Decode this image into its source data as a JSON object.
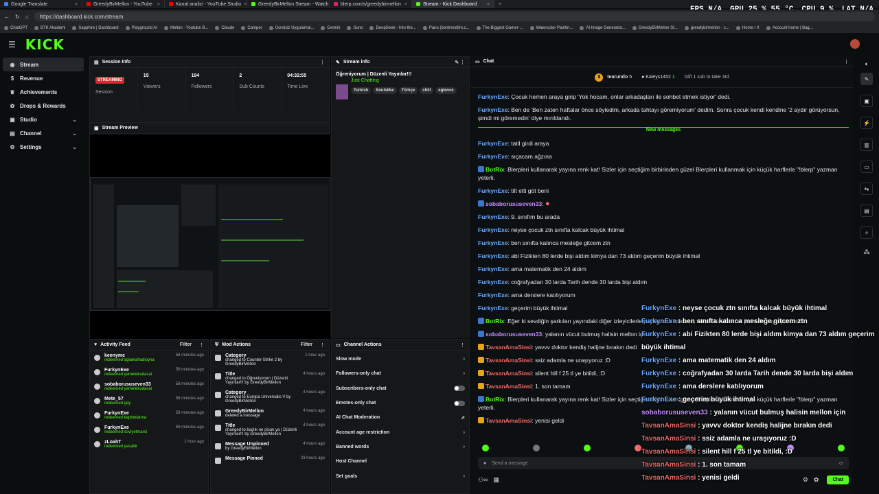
{
  "browser": {
    "tabs": [
      {
        "title": "Google Translate",
        "color": "#4285f4"
      },
      {
        "title": "GreedyBirMellon - YouTube",
        "color": "#ff0000"
      },
      {
        "title": "Kanal analizi - YouTube Studio",
        "color": "#ff0000"
      },
      {
        "title": "GreedyBirMellon Stream - Watch",
        "color": "#53fc18"
      },
      {
        "title": "blerp.com/s/greedybirmellon",
        "color": "#e0245e"
      },
      {
        "title": "Stream - Kick Dashboard",
        "color": "#53fc18",
        "active": true
      }
    ],
    "url": "https://dashboard.kick.com/stream",
    "bookmarks": [
      "ChatGPT",
      "BTK Akademi",
      "Sapphire | Dashboard",
      "Playground AI",
      "Mellon - Youtube B...",
      "Claude",
      "Camper",
      "Ücretsiz Uygulamal...",
      "Gemini",
      "Suno",
      "DeepSeek - Into the...",
      "Pano (bentrendlim.c...",
      "The Biggest Gamer-...",
      "Watercolor Paintin...",
      "AI Image Generator...",
      "GreedyBirMellon St...",
      "greedybirmellon - s...",
      "Home / X",
      "Account home | Bag..."
    ]
  },
  "hud": {
    "fps_label": "FPS",
    "fps": "N/A",
    "gpu_label": "GPU",
    "gpu": "25 % 55 °C",
    "cpu_label": "CPU",
    "cpu": "9 %",
    "lat_label": "LAT",
    "lat": "N/A"
  },
  "brand": {
    "logo": "KICK",
    "accent": "#53fc18"
  },
  "sidebar": {
    "items": [
      {
        "label": "Stream",
        "active": true,
        "icon": "broadcast-icon"
      },
      {
        "label": "Revenue",
        "icon": "revenue-icon"
      },
      {
        "label": "Achievements",
        "icon": "trophy-icon"
      },
      {
        "label": "Drops & Rewards",
        "icon": "gift-icon"
      },
      {
        "label": "Studio",
        "icon": "studio-icon",
        "chevron": true
      },
      {
        "label": "Channel",
        "icon": "channel-icon",
        "chevron": true
      },
      {
        "label": "Settings",
        "icon": "gear-icon",
        "chevron": true
      }
    ]
  },
  "session": {
    "title": "Session Info",
    "status": "STREAMING",
    "status_label": "Session",
    "stats": [
      {
        "value": "15",
        "label": "Viewers"
      },
      {
        "value": "194",
        "label": "Followers"
      },
      {
        "value": "2",
        "label": "Sub Counts"
      },
      {
        "value": "04:32:55",
        "label": "Time Live"
      }
    ]
  },
  "preview": {
    "title": "Stream Preview"
  },
  "stream_info": {
    "title": "Stream info",
    "stream_title": "Öğreniyorum | Düzenli Yayınlar!!!",
    "category": "Just Chatting",
    "tags": [
      "Turkish",
      "Soulslike",
      "Türkçe",
      "chill",
      "eglence"
    ]
  },
  "activity": {
    "title": "Activity Feed",
    "filter": "Filter",
    "items": [
      {
        "user": "keenymc",
        "detail": "redeemed aglamahadioyna",
        "time": "58 minutes ago"
      },
      {
        "user": "FurkynExe",
        "detail": "redeemed yametekudasai",
        "time": "58 minutes ago"
      },
      {
        "user": "sobaborususeven33",
        "detail": "redeemed yametekudasai",
        "time": "58 minutes ago"
      },
      {
        "user": "Mete_57",
        "detail": "redeemed gay",
        "time": "58 minutes ago"
      },
      {
        "user": "FurkynExe",
        "detail": "redeemed kaptoklatma",
        "time": "59 minutes ago"
      },
      {
        "user": "FurkynExe",
        "detail": "redeemed soviyetmarsi",
        "time": "59 minutes ago"
      },
      {
        "user": "zLoahT",
        "detail": "redeemed yasabir",
        "time": "1 hour ago"
      }
    ]
  },
  "mod_actions": {
    "title": "Mod Actions",
    "filter": "Filter",
    "items": [
      {
        "action": "Category",
        "detail": "changed to Counter-Strike 2 by GreedyBirMellon",
        "time": "1 hour ago"
      },
      {
        "action": "Title",
        "detail": "changed to Öğreniyorum | Düzenli Yayınlar!!! by GreedyBirMellon",
        "time": "4 hours ago"
      },
      {
        "action": "Category",
        "detail": "changed to Europa Universalis V by GreedyBirMellon",
        "time": "4 hours ago"
      },
      {
        "action": "GreedyBirMellon",
        "detail": "deleted a message",
        "time": "4 hours ago"
      },
      {
        "action": "Title",
        "detail": "changed to başlık ne olsun ya | Düzenli Yayınlar!!! by GreedyBirMellon",
        "time": "4 hours ago"
      },
      {
        "action": "Message Unpinned",
        "detail": "by GreedyBirMellon",
        "time": "4 hours ago"
      },
      {
        "action": "Message Pinned",
        "detail": "",
        "time": "23 hours ago"
      }
    ]
  },
  "channel_actions": {
    "title": "Channel Actions",
    "items": [
      {
        "label": "Slow mode",
        "kind": "arrow"
      },
      {
        "label": "Followers-only chat",
        "kind": "arrow"
      },
      {
        "label": "Subscribers-only chat",
        "kind": "toggle"
      },
      {
        "label": "Emotes-only chat",
        "kind": "toggle"
      },
      {
        "label": "AI Chat Moderation",
        "kind": "link"
      },
      {
        "label": "Account age restriction",
        "kind": "arrow"
      },
      {
        "label": "Banned words",
        "kind": "arrow"
      },
      {
        "label": "Host Channel",
        "kind": "none"
      },
      {
        "label": "Set goals",
        "kind": "arrow"
      }
    ]
  },
  "chat": {
    "title": "Chat",
    "pinned_user": "tearundo",
    "pinned_count": "5",
    "gifter": "Kaleys1452",
    "gift_count": "1",
    "gift_text": "Gift 1 sub to take 3rd",
    "new_messages_label": "New messages",
    "older": [
      {
        "user": "FurkynExe",
        "text": "Çocuk hemen araya girip 'Yok hocam, onlar arkadaşları ile sohbet etmek istiyor' dedi.",
        "cls": "u-f"
      },
      {
        "user": "FurkynExe",
        "text": "Ben de 'Ben zaten haftalar önce söyledim, arkada tahtayı göremiyorum' dedim. Sonra çocuk kendi kendine '2 aydır görüyorsun, şimdi mi göremedin' diye mırıldandı.",
        "cls": "u-f"
      }
    ],
    "messages": [
      {
        "user": "FurkynExe",
        "text": "tatil girdi araya",
        "cls": "u-f"
      },
      {
        "user": "FurkynExe",
        "text": "sıçacam ağzına",
        "cls": "u-f"
      },
      {
        "user": "BotRix",
        "text": "Blerpleri kullanarak yayına renk kat! Sizler için seçtiğim birbirinden güzel Blerpleri kullanmak için küçük harflerle \"!blerp\" yazman yeterli.",
        "cls": "u-b",
        "badge": true
      },
      {
        "user": "FurkynExe",
        "text": "tilt etti göt beni",
        "cls": "u-f"
      },
      {
        "user": "sobaborususeven33",
        "text": "",
        "cls": "u-s",
        "badge": true,
        "emote": true
      },
      {
        "user": "FurkynExe",
        "text": "9. sınıfım bu arada",
        "cls": "u-f"
      },
      {
        "user": "FurkynExe",
        "text": "neyse çocuk ztn sınıfta kalcak büyük ihtimal",
        "cls": "u-f"
      },
      {
        "user": "FurkynExe",
        "text": "ben sınıfta kalınca mesleğe gitcem ztn",
        "cls": "u-f"
      },
      {
        "user": "FurkynExe",
        "text": "abi Fizikten 80 lerde bişi aldım kimya dan 73 aldım geçerim büyük ihtimal",
        "cls": "u-f"
      },
      {
        "user": "FurkynExe",
        "text": "ama matematik den 24 aldım",
        "cls": "u-f"
      },
      {
        "user": "FurkynExe",
        "text": "coğrafyadan 30 larda Tarih dende 30 larda bişi aldım",
        "cls": "u-f"
      },
      {
        "user": "FurkynExe",
        "text": "ama derslere katılıyorum",
        "cls": "u-f"
      },
      {
        "user": "FurkynExe",
        "text": "geçerim büyük ihtimal",
        "cls": "u-f"
      },
      {
        "user": "BotRix",
        "text": "Eğer ki sevdiğin şarkıları yayındaki diğer izleyicilerle paylaşmak istersen, ufacık bir channel point ile paylaşabilirsin.",
        "cls": "u-b",
        "badge": true
      },
      {
        "user": "sobaborususeven33",
        "text": "yalanın vücut bulmuş halisin mellon için",
        "cls": "u-s",
        "badge": true
      },
      {
        "user": "TavsanAmaSinsi",
        "text": "yavvv doktor kendiş halijne bırakın dedi",
        "cls": "u-t",
        "badge": true
      },
      {
        "user": "TavsanAmaSinsi",
        "text": "ssiz adamla ne uraşıyoruz :D",
        "cls": "u-t",
        "badge": true
      },
      {
        "user": "TavsanAmaSinsi",
        "text": "silent hill f 25 tl ye bitildi, :D",
        "cls": "u-t",
        "badge": true
      },
      {
        "user": "TavsanAmaSinsi",
        "text": "1. son tamam",
        "cls": "u-t",
        "badge": true
      },
      {
        "user": "BotRix",
        "text": "Blerpleri kullanarak yayına renk kat! Sizler için seçtiğim birbirinden güzel Blerpleri kullanmak için küçük harflerle \"!blerp\" yazman yeterli.",
        "cls": "u-b",
        "badge": true
      },
      {
        "user": "TavsanAmaSinsi",
        "text": "yenisi geldi",
        "cls": "u-t",
        "badge": true
      }
    ],
    "input_placeholder": "Send a message",
    "send_label": "Chat"
  },
  "overlay": [
    {
      "user": "FurkynExe",
      "text": "neyse çocuk ztn sınıfta kalcak büyük ihtimal",
      "cls": "ou"
    },
    {
      "user": "FurkynExe",
      "text": "ben sınıfta kalınca mesleğe gitcem ztn",
      "cls": "ou"
    },
    {
      "user": "FurkynExe",
      "text": "abi Fizikten 80 lerde bişi aldım kimya dan 73 aldım geçerim büyük ihtimal",
      "cls": "ou"
    },
    {
      "user": "FurkynExe",
      "text": "ama matematik den 24 aldım",
      "cls": "ou"
    },
    {
      "user": "FurkynExe",
      "text": "coğrafyadan 30 larda Tarih dende 30 larda bişi aldım",
      "cls": "ou"
    },
    {
      "user": "FurkynExe",
      "text": "ama derslere katılıyorum",
      "cls": "ou"
    },
    {
      "user": "FurkynExe",
      "text": "geçerim büyük ihtimal",
      "cls": "ou"
    },
    {
      "user": "sobaborususeven33",
      "text": "yalanın vücut bulmuş halisin mellon için",
      "cls": "os"
    },
    {
      "user": "TavsanAmaSinsi",
      "text": "yavvv doktor kendiş halijne bırakın dedi",
      "cls": "ot"
    },
    {
      "user": "TavsanAmaSinsi",
      "text": "ssiz adamla ne uraşıyoruz :D",
      "cls": "ot"
    },
    {
      "user": "TavsanAmaSinsi",
      "text": "silent hill f 25 tl ye bitildi, :D",
      "cls": "ot"
    },
    {
      "user": "TavsanAmaSinsi",
      "text": "1. son tamam",
      "cls": "ot"
    },
    {
      "user": "TavsanAmaSinsi",
      "text": "yenisi geldi",
      "cls": "ot"
    }
  ]
}
